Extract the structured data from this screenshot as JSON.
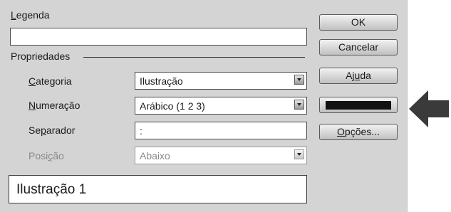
{
  "legenda": {
    "label_first": "L",
    "label_rest": "egenda",
    "value": ""
  },
  "propriedades": {
    "title": "Propriedades",
    "categoria": {
      "label_first": "C",
      "label_rest": "ategoria",
      "value": "Ilustração"
    },
    "numeracao": {
      "label_first": "N",
      "label_rest": "umeração",
      "value": "Arábico (1 2 3)"
    },
    "separador": {
      "label_a": "Se",
      "label_u": "p",
      "label_b": "arador",
      "value": ":"
    },
    "posicao": {
      "label_a": "Posi",
      "label_u": "ç",
      "label_b": "ão",
      "value": "Abaixo"
    }
  },
  "preview": {
    "text": "Ilustração 1"
  },
  "buttons": {
    "ok": "OK",
    "cancelar": "Cancelar",
    "ajuda_a": "Aj",
    "ajuda_u": "u",
    "ajuda_b": "da",
    "opcoes_u": "O",
    "opcoes_rest": "pções..."
  },
  "colors": {
    "dialog_bg": "#d4d4d4",
    "arrow": "#3a3a3a",
    "highlight_bar": "#111111"
  },
  "icons": {
    "arrow": "left-arrow-icon",
    "dropdown": "chevron-down-icon"
  }
}
